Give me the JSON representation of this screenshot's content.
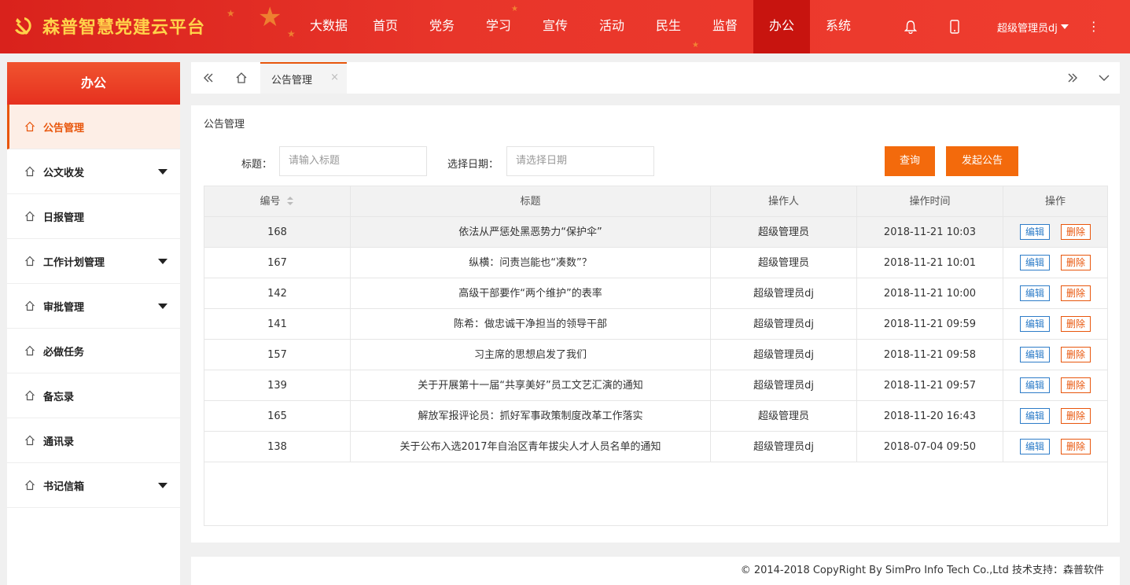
{
  "app": {
    "title": "森普智慧党建云平台"
  },
  "nav": {
    "items": [
      "大数据",
      "首页",
      "党务",
      "学习",
      "宣传",
      "活动",
      "民生",
      "监督",
      "办公",
      "系统"
    ],
    "active_index": 8
  },
  "header": {
    "user": "超级管理员dj",
    "icons": [
      "bell-icon",
      "mobile-icon",
      "more-icon"
    ]
  },
  "sidebar": {
    "title": "办公",
    "items": [
      {
        "label": "公告管理",
        "active": true,
        "has_submenu": false
      },
      {
        "label": "公文收发",
        "active": false,
        "has_submenu": true
      },
      {
        "label": "日报管理",
        "active": false,
        "has_submenu": false
      },
      {
        "label": "工作计划管理",
        "active": false,
        "has_submenu": true
      },
      {
        "label": "审批管理",
        "active": false,
        "has_submenu": true
      },
      {
        "label": "必做任务",
        "active": false,
        "has_submenu": false
      },
      {
        "label": "备忘录",
        "active": false,
        "has_submenu": false
      },
      {
        "label": "通讯录",
        "active": false,
        "has_submenu": false
      },
      {
        "label": "书记信箱",
        "active": false,
        "has_submenu": true
      }
    ]
  },
  "tabs": {
    "current": "公告管理",
    "close": "×"
  },
  "main": {
    "title": "公告管理",
    "filter": {
      "title_label": "标题：",
      "title_placeholder": "请输入标题",
      "date_label": "选择日期：",
      "date_placeholder": "请选择日期",
      "query_label": "查询",
      "publish_label": "发起公告"
    },
    "table": {
      "columns": [
        "编号",
        "标题",
        "操作人",
        "操作时间",
        "操作"
      ],
      "edit_label": "编辑",
      "delete_label": "删除",
      "rows": [
        {
          "id": "168",
          "title": "依法从严惩处黑恶势力“保护伞”",
          "operator": "超级管理员",
          "time": "2018-11-21 10:03"
        },
        {
          "id": "167",
          "title": "纵横：问责岂能也“凑数”？",
          "operator": "超级管理员",
          "time": "2018-11-21 10:01"
        },
        {
          "id": "142",
          "title": "高级干部要作“两个维护”的表率",
          "operator": "超级管理员dj",
          "time": "2018-11-21 10:00"
        },
        {
          "id": "141",
          "title": "陈希：做忠诚干净担当的领导干部",
          "operator": "超级管理员dj",
          "time": "2018-11-21 09:59"
        },
        {
          "id": "157",
          "title": "习主席的思想启发了我们",
          "operator": "超级管理员dj",
          "time": "2018-11-21 09:58"
        },
        {
          "id": "139",
          "title": "关于开展第十一届“共享美好”员工文艺汇演的通知",
          "operator": "超级管理员dj",
          "time": "2018-11-21 09:57"
        },
        {
          "id": "165",
          "title": "解放军报评论员：抓好军事政策制度改革工作落实",
          "operator": "超级管理员",
          "time": "2018-11-20 16:43"
        },
        {
          "id": "138",
          "title": "关于公布入选2017年自治区青年拔尖人才人员名单的通知",
          "operator": "超级管理员dj",
          "time": "2018-07-04 09:50"
        }
      ]
    }
  },
  "footer": {
    "text": "© 2014-2018 CopyRight By SimPro Info Tech Co.,Ltd 技术支持：森普软件"
  },
  "colors": {
    "brand_red": "#e8352a",
    "accent_orange": "#f36a0c",
    "edit_blue": "#2d7cc8",
    "title_gold": "#ffd24a"
  }
}
